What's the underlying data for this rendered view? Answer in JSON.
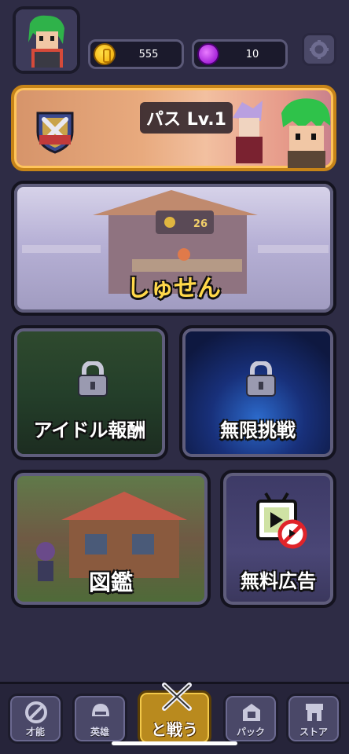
{
  "header": {
    "coins": "555",
    "gems": "10"
  },
  "cards": {
    "pass_title": "パス Lv.1",
    "shop_counter": "26",
    "shop_label": "しゅせん",
    "idle_label": "アイドル報酬",
    "endless_label": "無限挑戦",
    "book_label": "図鑑",
    "ad_label": "無料広告"
  },
  "nav": {
    "talent": "才能",
    "heroes": "英雄",
    "battle": "と戦う",
    "pack": "パック",
    "store": "ストア"
  },
  "colors": {
    "background": "#2e2c45",
    "pass_border": "#c78418",
    "battle_button": "#b98a1e"
  }
}
